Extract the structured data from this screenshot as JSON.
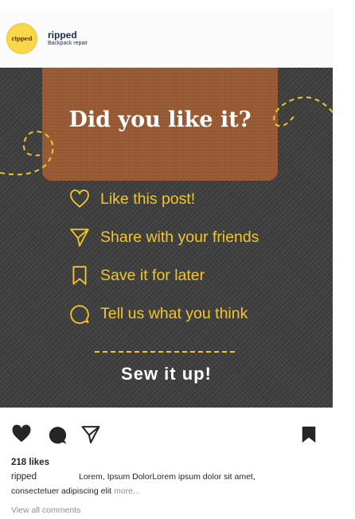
{
  "account": {
    "avatar_text": "ripped",
    "name": "ripped",
    "subtitle": "Backpack repair"
  },
  "post": {
    "headline": "Did you like it?",
    "actions": [
      {
        "icon": "heart-icon",
        "label": "Like this post!"
      },
      {
        "icon": "send-icon",
        "label": "Share with your friends"
      },
      {
        "icon": "bookmark-icon",
        "label": "Save it for later"
      },
      {
        "icon": "comment-icon",
        "label": "Tell us what you think"
      }
    ],
    "footer_text": "Sew it up!",
    "colors": {
      "accent": "#f3c52d",
      "leather": "#9a5a34",
      "denim": "#3f3f3f"
    }
  },
  "interaction_bar": {
    "likes": "218 likes",
    "caption_user": "ripped",
    "caption_text": "Lorem, Ipsum DolorLorem ipsum dolor sit amet,",
    "caption_line2": "consectetuer adipiscing elit",
    "more_label": "more...",
    "view_all_comments": "View all comments"
  }
}
